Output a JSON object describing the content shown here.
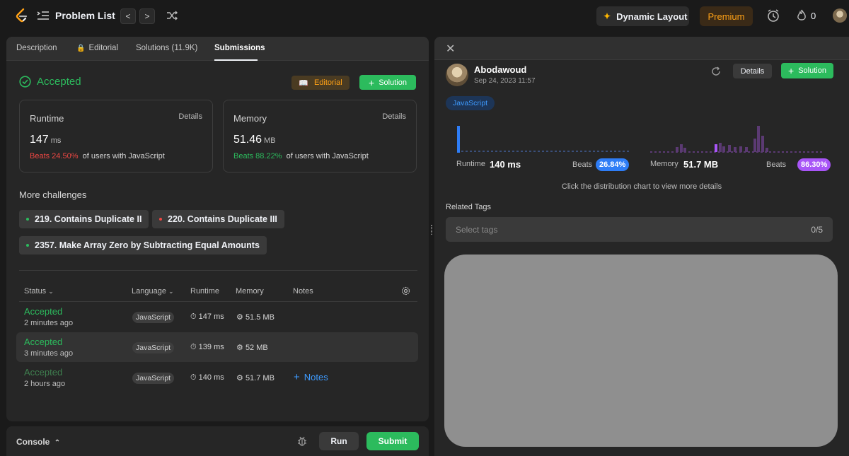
{
  "topbar": {
    "title": "Problem List",
    "prev_label": "<",
    "next_label": ">",
    "dynamic_layout": "Dynamic Layout",
    "premium": "Premium",
    "streak": "0"
  },
  "tabs": [
    {
      "label": "Description"
    },
    {
      "label": "Editorial"
    },
    {
      "label": "Solutions (11.9K)"
    },
    {
      "label": "Submissions"
    }
  ],
  "result": {
    "status": "Accepted",
    "editorial_btn": "Editorial",
    "solution_btn": "Solution"
  },
  "runtime_card": {
    "title": "Runtime",
    "details": "Details",
    "value": "147",
    "unit": "ms",
    "beats": "Beats 24.50%",
    "suffix": "of users with JavaScript"
  },
  "memory_card": {
    "title": "Memory",
    "details": "Details",
    "value": "51.46",
    "unit": "MB",
    "beats": "Beats 88.22%",
    "suffix": "of users with JavaScript"
  },
  "challenges": {
    "heading": "More challenges",
    "items": [
      {
        "label": "219. Contains Duplicate II",
        "dot_color": "#2cbb5d"
      },
      {
        "label": "220. Contains Duplicate III",
        "dot_color": "#ef4743"
      },
      {
        "label": "2357. Make Array Zero by Subtracting Equal Amounts",
        "dot_color": "#2cbb5d"
      }
    ]
  },
  "table": {
    "headers": {
      "status": "Status",
      "language": "Language",
      "runtime": "Runtime",
      "memory": "Memory",
      "notes": "Notes"
    },
    "rows": [
      {
        "status": "Accepted",
        "time": "2 minutes ago",
        "language": "JavaScript",
        "runtime": "147 ms",
        "memory": "51.5 MB"
      },
      {
        "status": "Accepted",
        "time": "3 minutes ago",
        "language": "JavaScript",
        "runtime": "139 ms",
        "memory": "52 MB"
      },
      {
        "status": "Accepted",
        "time": "2 hours ago",
        "language": "JavaScript",
        "runtime": "140 ms",
        "memory": "51.7 MB",
        "notes": "Notes"
      }
    ]
  },
  "console": {
    "label": "Console",
    "run": "Run",
    "submit": "Submit"
  },
  "detail": {
    "user": "Abodawoud",
    "date": "Sep 24, 2023 11:57",
    "details_btn": "Details",
    "solution_btn": "Solution",
    "language": "JavaScript",
    "runtime_label": "Runtime",
    "runtime_value": "140 ms",
    "runtime_beats_label": "Beats",
    "runtime_beats": "26.84%",
    "memory_label": "Memory",
    "memory_value": "51.7 MB",
    "memory_beats_label": "Beats",
    "memory_beats": "86.30%",
    "hint": "Click the distribution chart to view more details",
    "related_tags": "Related Tags",
    "tags_placeholder": "Select tags",
    "tags_count": "0/5"
  },
  "colors": {
    "accent_green": "#2cbb5d",
    "accent_orange": "#ffa116",
    "accent_blue": "#3e9bff",
    "error_red": "#ef4743",
    "memory_purple": "#a855f7"
  }
}
